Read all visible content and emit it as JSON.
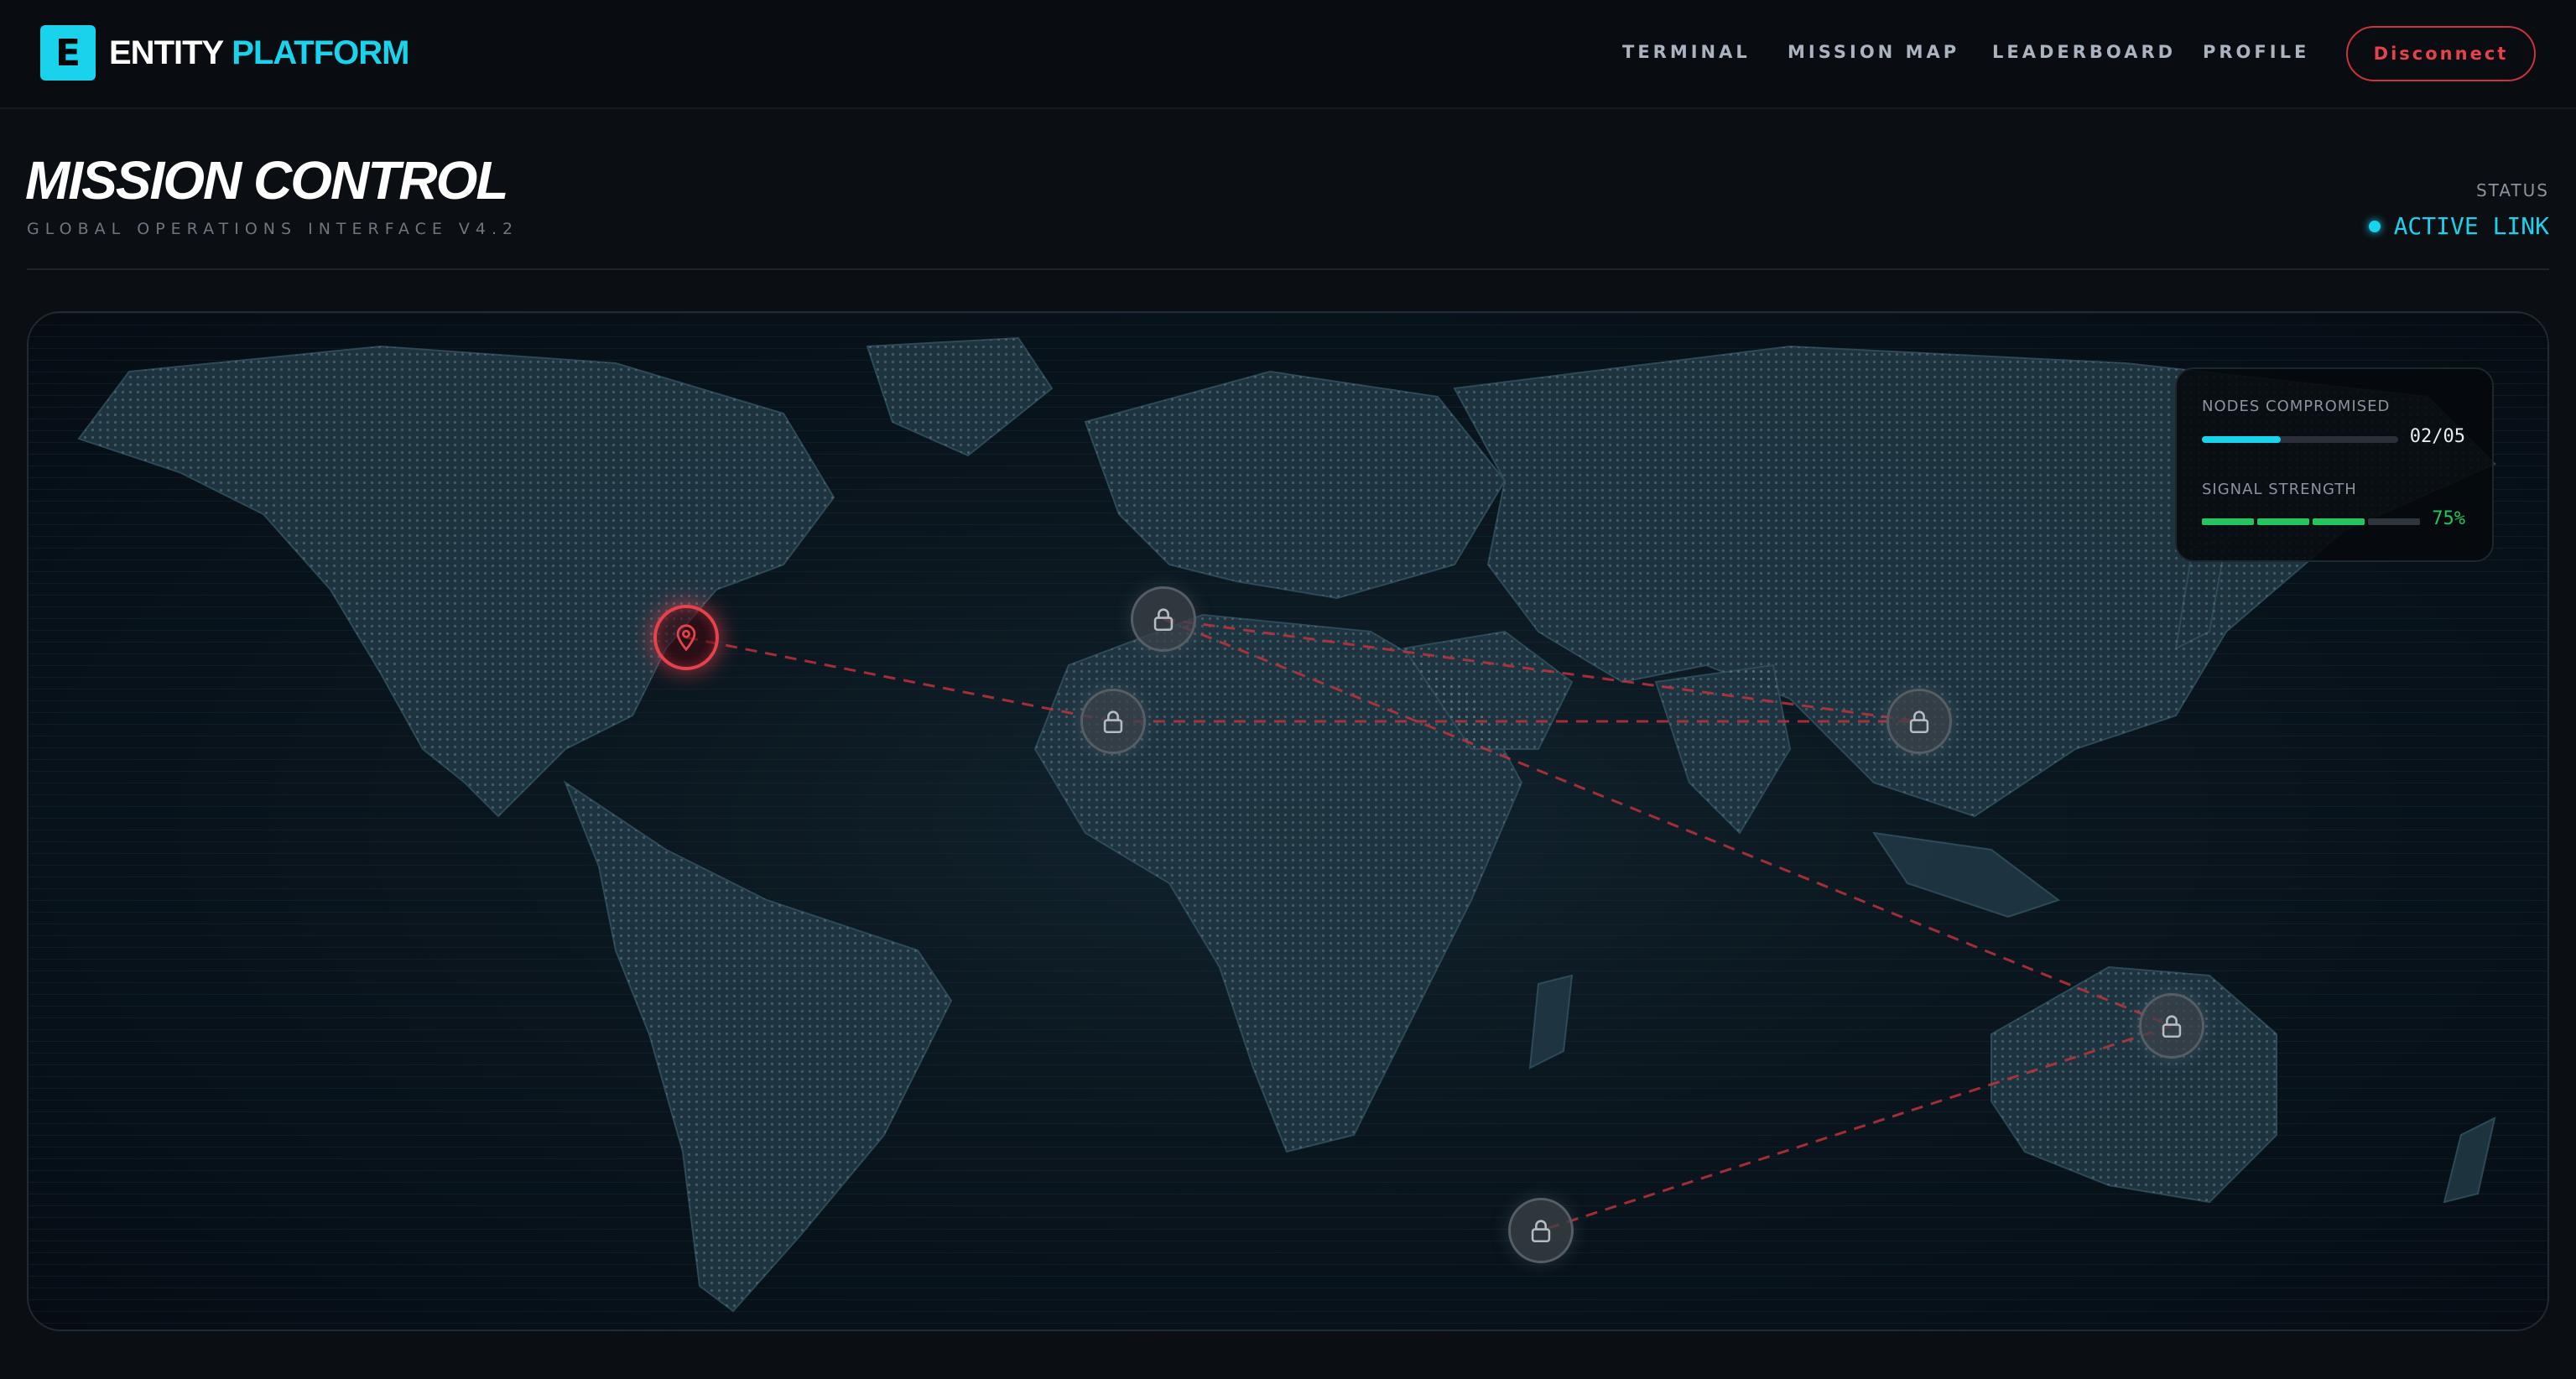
{
  "brand": {
    "mark": "E",
    "name_primary": "ENTITY",
    "name_accent": "PLATFORM"
  },
  "nav": {
    "items": [
      {
        "label": "TERMINAL"
      },
      {
        "label": "MISSION MAP"
      },
      {
        "label": "LEADERBOARD"
      },
      {
        "label": "PROFILE"
      }
    ],
    "disconnect_label": "Disconnect"
  },
  "header": {
    "title": "MISSION CONTROL",
    "subtitle": "GLOBAL OPERATIONS INTERFACE V4.2",
    "status_label": "STATUS",
    "status_value": "ACTIVE LINK"
  },
  "map": {
    "nodes": [
      {
        "id": "north-america",
        "state": "active",
        "icon": "map-pin-icon"
      },
      {
        "id": "north-africa",
        "state": "locked",
        "icon": "lock-icon"
      },
      {
        "id": "west-africa",
        "state": "locked",
        "icon": "lock-icon"
      },
      {
        "id": "east-asia",
        "state": "locked",
        "icon": "lock-icon"
      },
      {
        "id": "australia",
        "state": "locked",
        "icon": "lock-icon"
      },
      {
        "id": "southern-ocean",
        "state": "locked",
        "icon": "lock-icon"
      }
    ]
  },
  "stats": {
    "nodes_compromised": {
      "label": "NODES COMPROMISED",
      "value": "02/05",
      "fraction": 0.4
    },
    "signal_strength": {
      "label": "SIGNAL STRENGTH",
      "value": "75%",
      "segments_total": 4,
      "segments_on": 3
    }
  },
  "colors": {
    "accent": "#19d3ec",
    "danger": "#e5424b",
    "success": "#22c55e",
    "background": "#0b0e13"
  }
}
